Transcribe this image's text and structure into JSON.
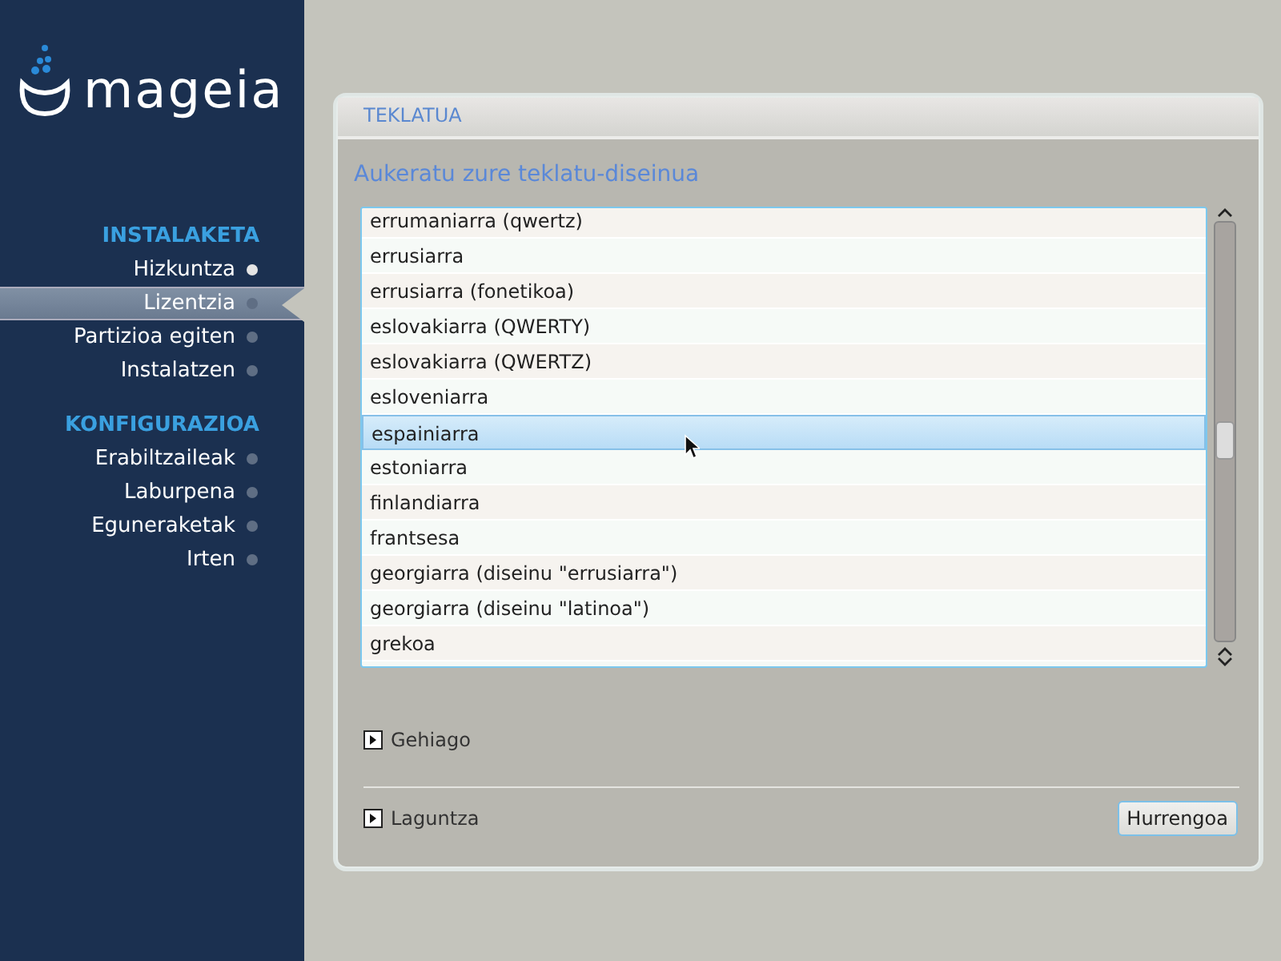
{
  "sidebar": {
    "logo": "mageia",
    "sections": [
      {
        "title": "INSTALAKETA",
        "items": [
          {
            "label": "Hizkuntza",
            "selected": false,
            "done": true
          },
          {
            "label": "Lizentzia",
            "selected": true,
            "done": false
          },
          {
            "label": "Partizioa egiten",
            "selected": false,
            "done": false
          },
          {
            "label": "Instalatzen",
            "selected": false,
            "done": false
          }
        ]
      },
      {
        "title": "KONFIGURAZIOA",
        "items": [
          {
            "label": "Erabiltzaileak",
            "selected": false,
            "done": false
          },
          {
            "label": "Laburpena",
            "selected": false,
            "done": false
          },
          {
            "label": "Eguneraketak",
            "selected": false,
            "done": false
          },
          {
            "label": "Irten",
            "selected": false,
            "done": false
          }
        ]
      }
    ]
  },
  "panel": {
    "title": "TEKLATUA",
    "heading": "Aukeratu zure teklatu-diseinua",
    "layouts": [
      {
        "label": "errumaniarra (qwertz)",
        "selected": false
      },
      {
        "label": "errusiarra",
        "selected": false
      },
      {
        "label": "errusiarra (fonetikoa)",
        "selected": false
      },
      {
        "label": "eslovakiarra (QWERTY)",
        "selected": false
      },
      {
        "label": "eslovakiarra (QWERTZ)",
        "selected": false
      },
      {
        "label": "esloveniarra",
        "selected": false
      },
      {
        "label": "espainiarra",
        "selected": true
      },
      {
        "label": "estoniarra",
        "selected": false
      },
      {
        "label": "finlandiarra",
        "selected": false
      },
      {
        "label": "frantsesa",
        "selected": false
      },
      {
        "label": "georgiarra (diseinu \"errusiarra\")",
        "selected": false
      },
      {
        "label": "georgiarra (diseinu \"latinoa\")",
        "selected": false
      },
      {
        "label": "grekoa",
        "selected": false
      }
    ],
    "more": {
      "label": "Gehiago",
      "expanded": false
    },
    "help": {
      "label": "Laguntza",
      "expanded": false
    },
    "next_button": "Hurrengoa"
  }
}
